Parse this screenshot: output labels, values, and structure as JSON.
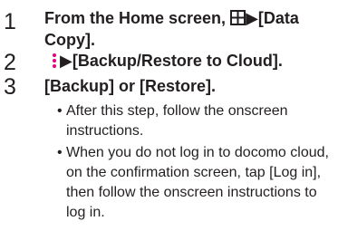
{
  "steps": [
    {
      "number": "1",
      "prefix": "From the Home screen, ",
      "icon": "apps-grid-icon",
      "arrow": "▶",
      "menu": "[Data",
      "line2": "Copy]."
    },
    {
      "number": "2",
      "icon": "more-options-icon",
      "text": "▶[Backup/Restore to Cloud]."
    },
    {
      "number": "3",
      "text": "[Backup] or [Restore].",
      "bullets": [
        "After this step, follow the onscreen instructions.",
        "When you do not log in to docomo cloud, on the confirmation screen, tap [Log in], then follow the onscreen instructions to log in."
      ]
    }
  ],
  "colors": {
    "text": "#231f20",
    "icon_accent": "#e4007f"
  }
}
